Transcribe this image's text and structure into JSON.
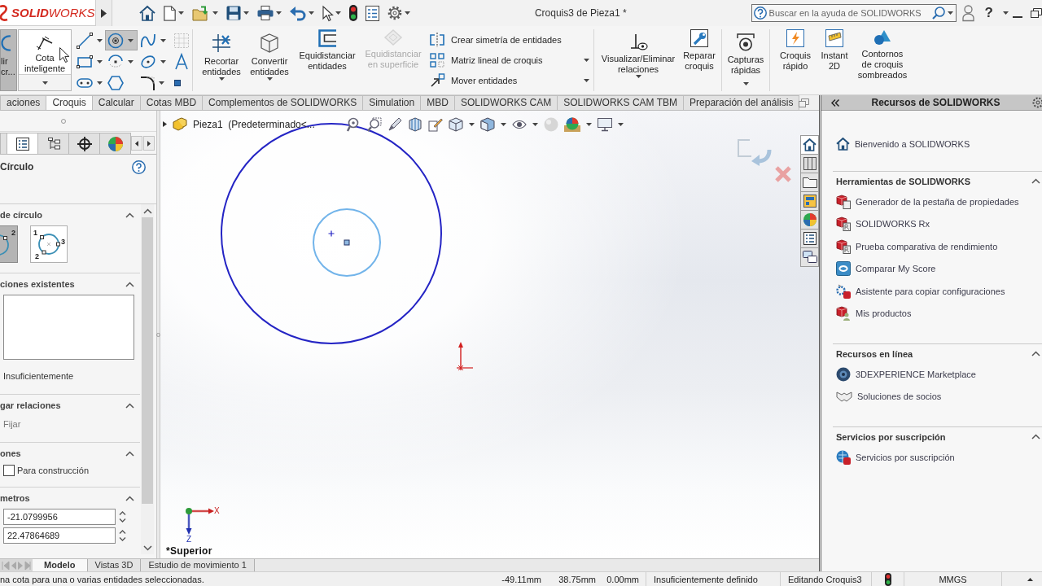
{
  "title_bar": {
    "logo": "**SOLID**WORKS",
    "title": "Croquis3 de Pieza1 *",
    "search": {
      "placeholder": "Buscar en la ayuda de SOLIDWORKS"
    },
    "help": "?"
  },
  "ribbon": {
    "exit_sketch": {
      "label": "lir\ncr...",
      "selected": true
    },
    "smart_dimension": {
      "label": "Cota\ninteligente",
      "menu": true
    },
    "sketch_tools": [
      {
        "selected": false,
        "menu": true,
        "disabled": false
      },
      {
        "selected": true,
        "menu": true,
        "disabled": false
      },
      {
        "selected": false,
        "menu": true,
        "disabled": false
      },
      {
        "selected": false,
        "menu": false,
        "disabled": true
      },
      {
        "selected": false,
        "menu": true,
        "disabled": false
      },
      {
        "selected": false,
        "menu": true,
        "disabled": false
      },
      {
        "selected": false,
        "menu": true,
        "disabled": false
      },
      {
        "selected": false,
        "menu": false,
        "disabled": false
      },
      {
        "selected": false,
        "menu": true,
        "disabled": false
      },
      {
        "selected": false,
        "menu": false,
        "disabled": false
      },
      {
        "selected": false,
        "menu": true,
        "disabled": false
      },
      {
        "selected": false,
        "menu": false,
        "disabled": false
      }
    ],
    "commands": [
      {
        "label": "Recortar\nentidades",
        "menu": true,
        "disabled": false
      },
      {
        "label": "Convertir\nentidades",
        "menu": true,
        "disabled": false
      },
      {
        "label": "Equidistanciar\nentidades",
        "menu": false,
        "disabled": false
      },
      {
        "label": "Equidistanciar\nen superficie",
        "menu": false,
        "disabled": true
      }
    ],
    "list_commands": [
      {
        "label": "Crear simetría de entidades",
        "menu": false
      },
      {
        "label": "Matriz lineal de croquis",
        "menu": true
      },
      {
        "label": "Mover entidades",
        "menu": true
      }
    ],
    "relation_commands": [
      {
        "label": "Visualizar/Eliminar\nrelaciones",
        "menu": true
      },
      {
        "label": "Reparar\ncroquis",
        "menu": false
      }
    ],
    "capture_commands": [
      {
        "label": "Capturas\nrápidas",
        "menu": true
      }
    ],
    "quick_commands": [
      {
        "label": "Croquis\nrápido"
      },
      {
        "label": "Instant\n2D"
      },
      {
        "label": "Contornos\nde croquis\nsombreados"
      }
    ]
  },
  "command_tabs": [
    {
      "label": "aciones",
      "selected": false
    },
    {
      "label": "Croquis",
      "selected": true
    },
    {
      "label": "Calcular",
      "selected": false
    },
    {
      "label": "Cotas MBD",
      "selected": false
    },
    {
      "label": "Complementos de SOLIDWORKS",
      "selected": false
    },
    {
      "label": "Simulation",
      "selected": false
    },
    {
      "label": "MBD",
      "selected": false
    },
    {
      "label": "SOLIDWORKS CAM",
      "selected": false
    },
    {
      "label": "SOLIDWORKS CAM TBM",
      "selected": false
    },
    {
      "label": "Preparación del análisis",
      "selected": false
    }
  ],
  "property_manager": {
    "tabs": [
      {
        "selected": false
      },
      {
        "selected": true
      },
      {
        "selected": false
      },
      {
        "selected": false
      },
      {
        "selected": false
      }
    ],
    "title": "Círculo",
    "sections": [
      {
        "kind": "circle_type",
        "title": "de círculo",
        "expanded": true,
        "options": [
          {
            "selected": true,
            "points": [
              "2"
            ]
          },
          {
            "selected": false,
            "points": [
              "1",
              "3",
              "2"
            ]
          }
        ]
      },
      {
        "kind": "relations",
        "title": "ciones existentes",
        "expanded": true,
        "status": "Insuficientemente"
      },
      {
        "kind": "add_relations",
        "title": "gar relaciones",
        "expanded": true,
        "items": [
          "Fijar"
        ]
      },
      {
        "kind": "options",
        "title": "ones",
        "expanded": true,
        "checkboxes": [
          {
            "label": "Para construcción",
            "checked": false
          }
        ]
      },
      {
        "kind": "parameters",
        "title": "metros",
        "expanded": true,
        "fields": [
          {
            "value": "-21.0799956"
          },
          {
            "value": "22.47864689"
          }
        ]
      }
    ]
  },
  "canvas": {
    "tree_flyout": {
      "label": "Pieza1  (Predeterminado<...",
      "expanded": false
    },
    "triad": {
      "x_label": "X",
      "z_label": "Z"
    },
    "view_name": "*Superior",
    "task_pane_tabs": [
      {
        "selected": true
      },
      {
        "selected": false
      },
      {
        "selected": false
      },
      {
        "selected": false
      },
      {
        "selected": false
      },
      {
        "selected": false
      },
      {
        "selected": false
      }
    ]
  },
  "right_panel": {
    "title": "Recursos de SOLIDWORKS",
    "welcome": "Bienvenido a SOLIDWORKS",
    "sections": [
      {
        "title": "Herramientas de SOLIDWORKS",
        "expanded": true,
        "items": [
          "Generador de la pestaña de propiedades",
          "SOLIDWORKS Rx",
          "Prueba comparativa de rendimiento",
          "Comparar My Score",
          "Asistente para copiar configuraciones",
          "Mis productos"
        ]
      },
      {
        "title": "Recursos en línea",
        "expanded": true,
        "items": [
          "3DEXPERIENCE Marketplace",
          "Soluciones de socios"
        ]
      },
      {
        "title": "Servicios por suscripción",
        "expanded": true,
        "items": [
          "Servicios por suscripción"
        ]
      }
    ]
  },
  "bottom_tabs": [
    {
      "label": "Modelo",
      "selected": true
    },
    {
      "label": "Vistas 3D",
      "selected": false
    },
    {
      "label": "Estudio de movimiento 1",
      "selected": false
    }
  ],
  "status_bar": {
    "message": "na cota para una o varias entidades seleccionadas.",
    "x": "-49.11mm",
    "y": "38.75mm",
    "z": "0.00mm",
    "state": "Insuficientemente definido",
    "editing": "Editando Croquis3",
    "units": "MMGS"
  }
}
